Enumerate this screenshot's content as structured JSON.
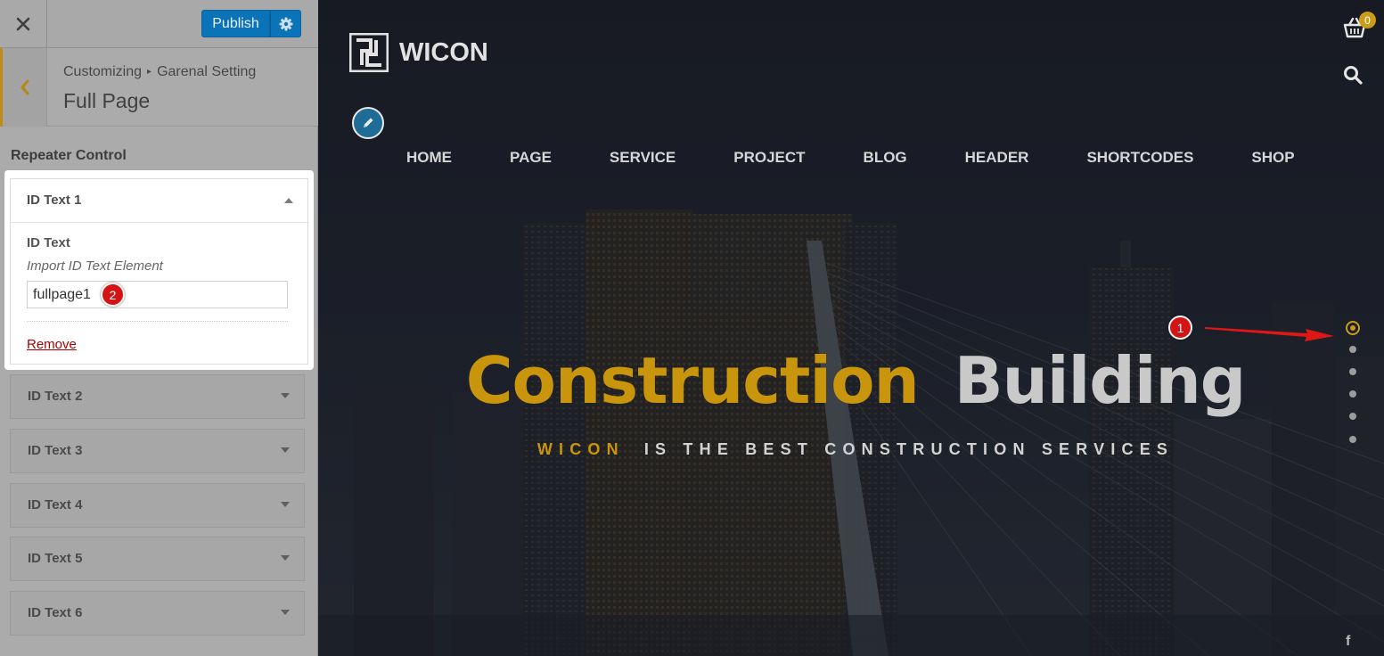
{
  "customizer": {
    "publish_label": "Publish",
    "breadcrumb": {
      "root": "Customizing",
      "parent": "Garenal Setting"
    },
    "section_title": "Full Page",
    "control_label": "Repeater Control",
    "open_item": {
      "title": "ID Text 1",
      "field_label": "ID Text",
      "field_description": "Import ID Text Element",
      "field_value": "fullpage1",
      "remove_label": "Remove"
    },
    "collapsed_items": [
      {
        "title": "ID Text 2"
      },
      {
        "title": "ID Text 3"
      },
      {
        "title": "ID Text 4"
      },
      {
        "title": "ID Text 5"
      },
      {
        "title": "ID Text 6"
      }
    ]
  },
  "annotations": {
    "badge_1": "1",
    "badge_2": "2"
  },
  "preview": {
    "logo_text": "WICON",
    "nav": [
      "HOME",
      "PAGE",
      "SERVICE",
      "PROJECT",
      "BLOG",
      "HEADER",
      "SHORTCODES",
      "SHOP"
    ],
    "cart_count": "0",
    "hero": {
      "title_highlight": "Construction",
      "title_rest": "Building",
      "subtitle_brand": "WICON",
      "subtitle_rest": "IS THE BEST CONSTRUCTION SERVICES"
    },
    "fullpage_nav": {
      "dots": 6,
      "active_index": 0
    },
    "social_icon": "facebook-icon",
    "colors": {
      "accent": "#c9950d",
      "publish": "#0b73b7",
      "back_accent": "#c08a1b",
      "badge": "#d41414"
    }
  }
}
